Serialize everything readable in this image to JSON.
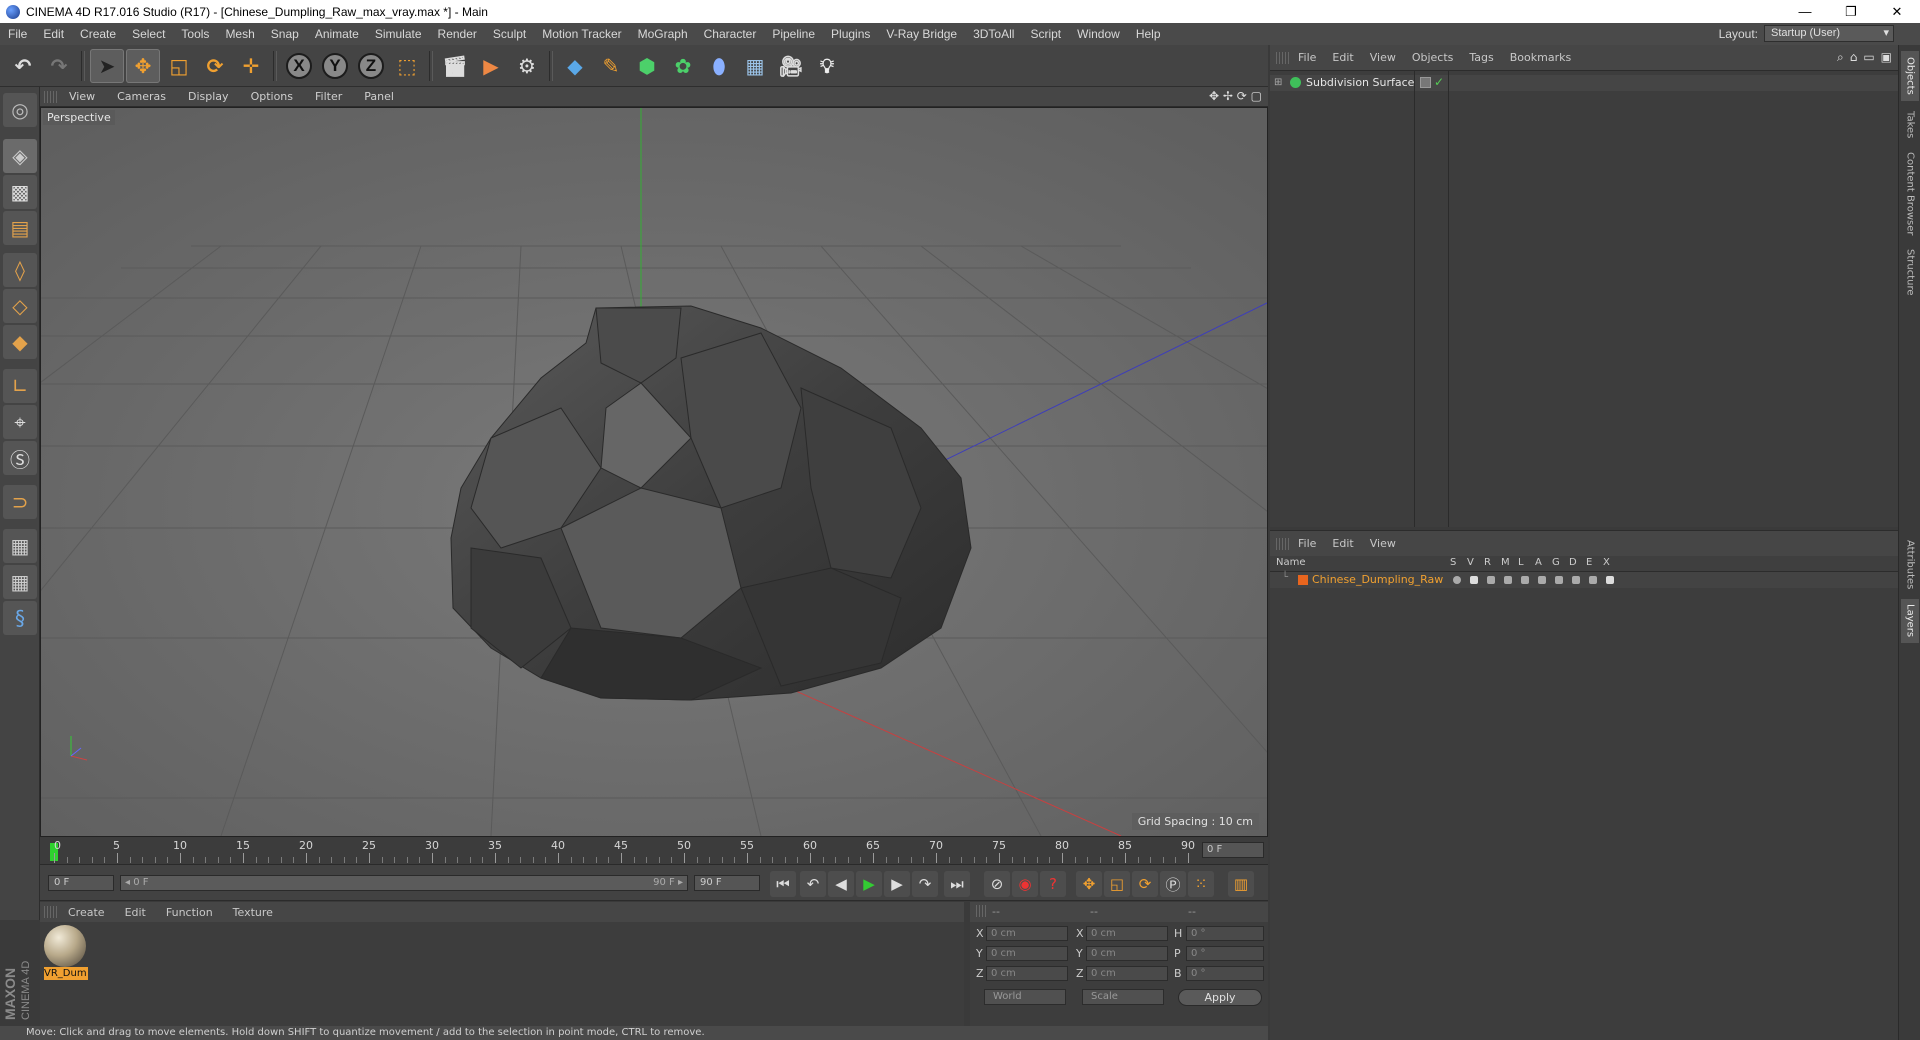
{
  "window": {
    "title": "CINEMA 4D R17.016 Studio (R17) - [Chinese_Dumpling_Raw_max_vray.max *] - Main",
    "minimize": "—",
    "restore": "❐",
    "close": "✕"
  },
  "menu": [
    "File",
    "Edit",
    "Create",
    "Select",
    "Tools",
    "Mesh",
    "Snap",
    "Animate",
    "Simulate",
    "Render",
    "Sculpt",
    "Motion Tracker",
    "MoGraph",
    "Character",
    "Pipeline",
    "Plugins",
    "V-Ray Bridge",
    "3DToAll",
    "Script",
    "Window",
    "Help"
  ],
  "layout": {
    "label": "Layout:",
    "value": "Startup (User)"
  },
  "toolbar": {
    "axis_x": "X",
    "axis_y": "Y",
    "axis_z": "Z"
  },
  "viewport": {
    "menu": [
      "View",
      "Cameras",
      "Display",
      "Options",
      "Filter",
      "Panel"
    ],
    "camera_label": "Perspective",
    "grid_spacing": "Grid Spacing : 10 cm",
    "nav_icons": "✥ ✢ ⟳ ▢"
  },
  "timeline": {
    "ticks": [
      "0",
      "5",
      "10",
      "15",
      "20",
      "25",
      "30",
      "35",
      "40",
      "45",
      "50",
      "55",
      "60",
      "65",
      "70",
      "75",
      "80",
      "85",
      "90"
    ],
    "current_frame": "0 F",
    "start_field": "0 F",
    "range_start": "◂ 0 F",
    "range_end": "90 F ▸",
    "end_field": "90 F"
  },
  "transport": {
    "first": "⏮",
    "prev_key": "↶",
    "prev": "◀",
    "play": "▶",
    "next": "▶",
    "next_key": "↷",
    "last": "⏭"
  },
  "materials": {
    "menu": [
      "Create",
      "Edit",
      "Function",
      "Texture"
    ],
    "items": [
      {
        "name": "VR_Dum"
      }
    ]
  },
  "coords": {
    "header": [
      "--",
      "--",
      "--"
    ],
    "rows": [
      {
        "a": "X",
        "av": "0 cm",
        "b": "X",
        "bv": "0 cm",
        "c": "H",
        "cv": "0 °"
      },
      {
        "a": "Y",
        "av": "0 cm",
        "b": "Y",
        "bv": "0 cm",
        "c": "P",
        "cv": "0 °"
      },
      {
        "a": "Z",
        "av": "0 cm",
        "b": "Z",
        "bv": "0 cm",
        "c": "B",
        "cv": "0 °"
      }
    ],
    "space": "World",
    "mode": "Scale",
    "apply": "Apply"
  },
  "objects": {
    "menu": [
      "File",
      "Edit",
      "View",
      "Objects",
      "Tags",
      "Bookmarks"
    ],
    "items": [
      {
        "name": "Subdivision Surface"
      }
    ]
  },
  "layers": {
    "menu": [
      "File",
      "Edit",
      "View"
    ],
    "columns": [
      "Name",
      "S",
      "V",
      "R",
      "M",
      "L",
      "A",
      "G",
      "D",
      "E",
      "X"
    ],
    "items": [
      {
        "name": "Chinese_Dumpling_Raw",
        "color": "#e8651e"
      }
    ]
  },
  "right_tabs": [
    "Objects",
    "Takes",
    "Content Browser",
    "Structure",
    "Attributes",
    "Layers"
  ],
  "brand": {
    "maxon": "MAXON",
    "product": "CINEMA 4D"
  },
  "status": "Move: Click and drag to move elements. Hold down SHIFT to quantize movement / add to the selection in point mode, CTRL to remove.",
  "colors": {
    "accent": "#f0a030",
    "viewport_bg": "#6b6b6b",
    "panel_bg": "#3d3d3d"
  }
}
